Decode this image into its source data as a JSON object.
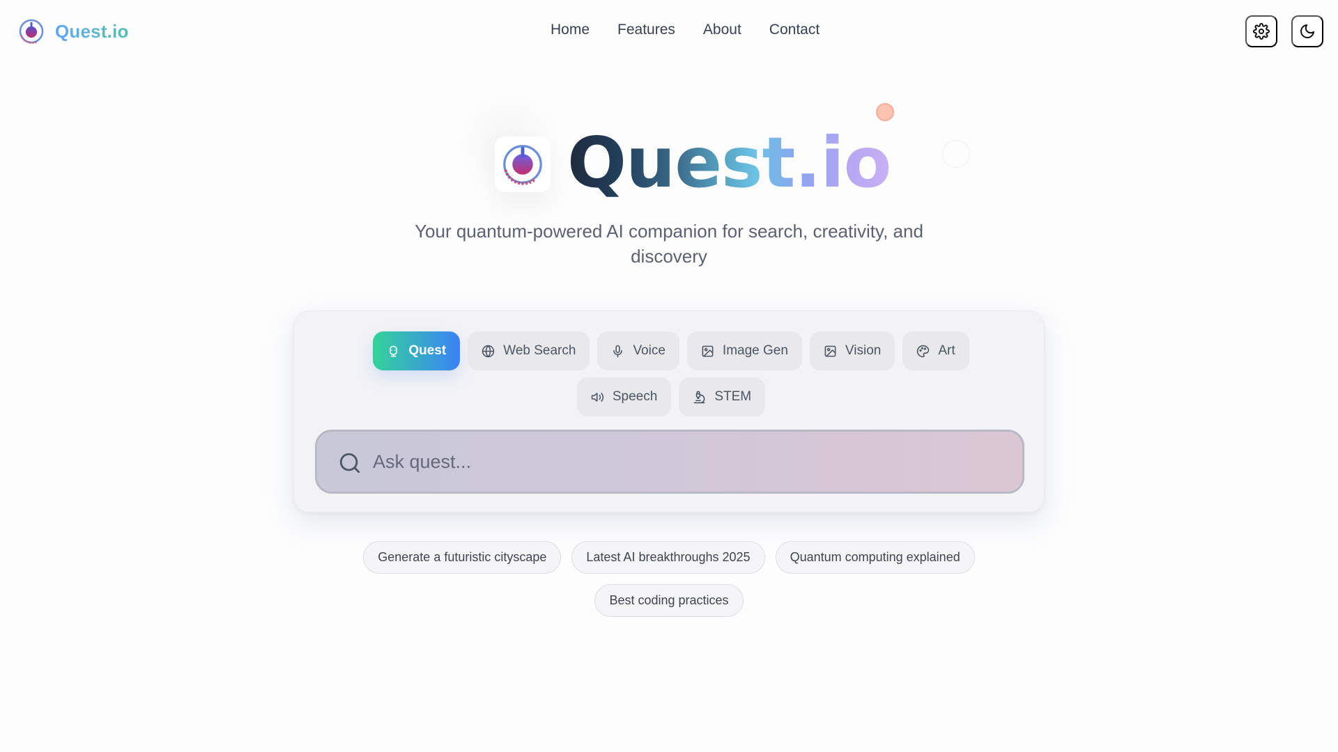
{
  "brand": {
    "name": "Quest.io",
    "logo_icon": "quest-logo-icon"
  },
  "nav": {
    "links": [
      "Home",
      "Features",
      "About",
      "Contact"
    ],
    "settings_icon": "gear-icon",
    "theme_icon": "moon-icon"
  },
  "hero": {
    "title": "Quest.io",
    "subtitle": "Your quantum-powered AI companion for search, creativity, and discovery"
  },
  "modes": [
    {
      "label": "Quest",
      "icon": "robot-icon",
      "active": true
    },
    {
      "label": "Web Search",
      "icon": "globe-icon",
      "active": false
    },
    {
      "label": "Voice",
      "icon": "microphone-icon",
      "active": false
    },
    {
      "label": "Image Gen",
      "icon": "image-icon",
      "active": false
    },
    {
      "label": "Vision",
      "icon": "image-icon",
      "active": false
    },
    {
      "label": "Art",
      "icon": "palette-icon",
      "active": false
    },
    {
      "label": "Speech",
      "icon": "speaker-icon",
      "active": false
    },
    {
      "label": "STEM",
      "icon": "microscope-icon",
      "active": false
    }
  ],
  "search": {
    "placeholder": "Ask quest...",
    "value": ""
  },
  "suggestions": [
    "Generate a futuristic cityscape",
    "Latest AI breakthroughs 2025",
    "Quantum computing explained",
    "Best coding practices"
  ],
  "colors": {
    "accent_start": "#34d399",
    "accent_end": "#3b82f6",
    "brand_gradient_start": "#1f2a3d",
    "brand_gradient_end": "#c7b2f3"
  }
}
